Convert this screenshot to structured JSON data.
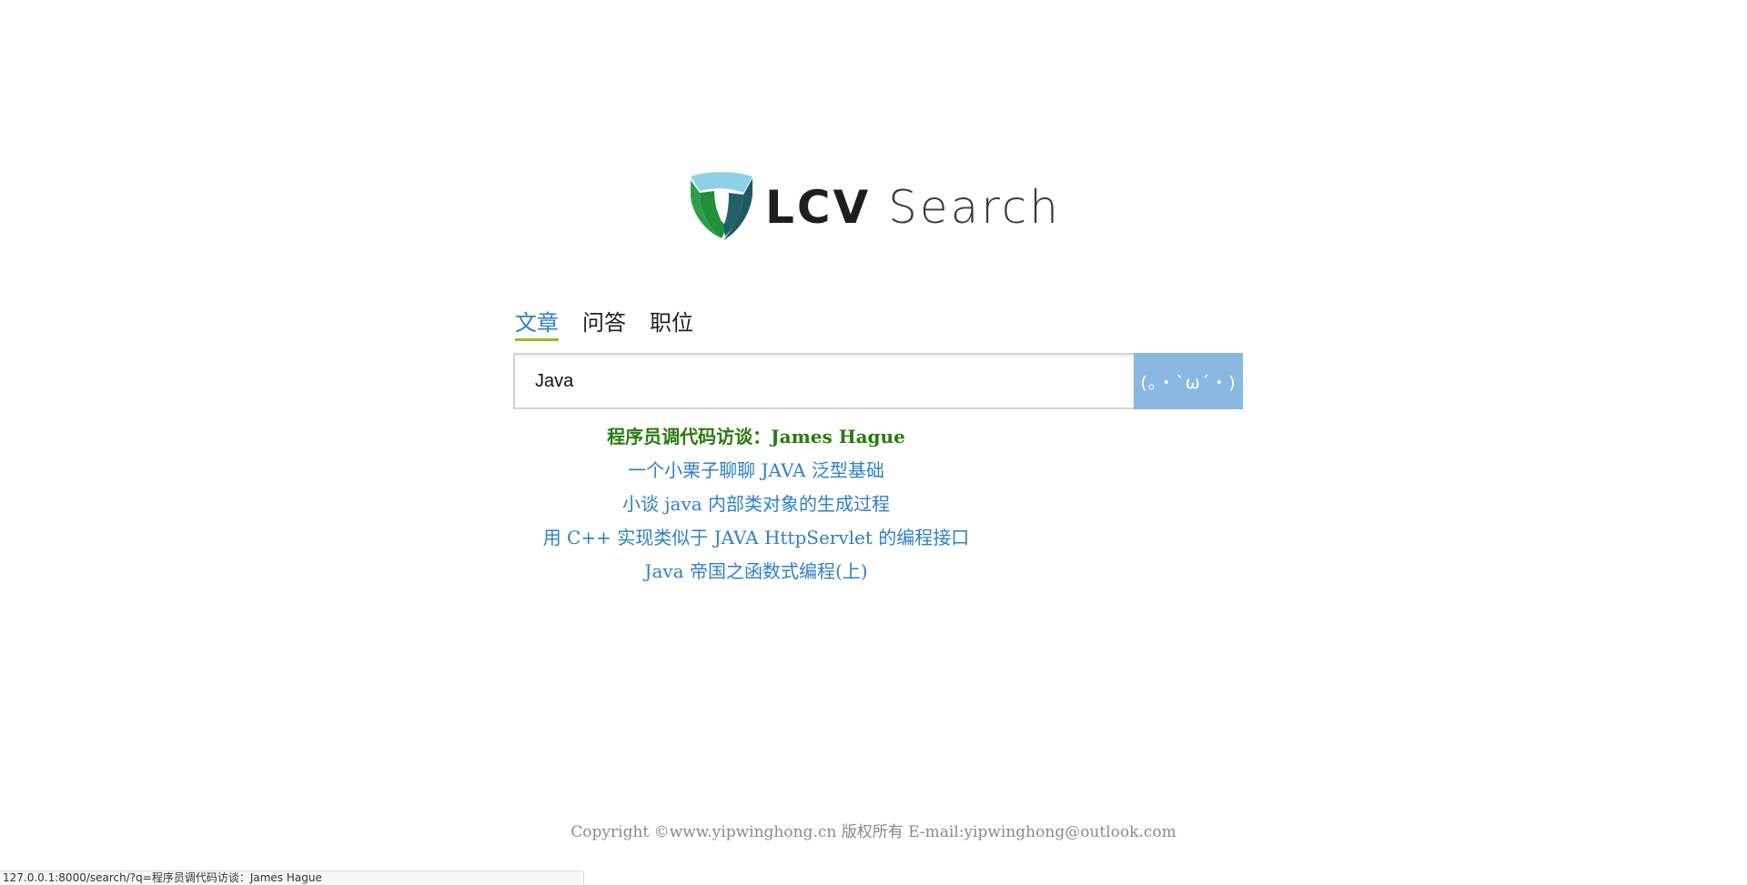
{
  "logo": {
    "text_bold": "LCV",
    "text_light": "Search",
    "colors": {
      "green": "#2aa046",
      "dark_teal": "#1d5a5e",
      "light_blue": "#8fd0e8"
    }
  },
  "tabs": [
    {
      "label": "文章",
      "active": true
    },
    {
      "label": "问答",
      "active": false
    },
    {
      "label": "职位",
      "active": false
    }
  ],
  "search": {
    "value": "Java",
    "placeholder": "",
    "button_label": "(｡・`ω´・)"
  },
  "suggestions": [
    {
      "text": "程序员调代码访谈：James Hague",
      "highlighted": true
    },
    {
      "text": "一个小栗子聊聊 JAVA 泛型基础",
      "highlighted": false
    },
    {
      "text": "小谈 java 内部类对象的生成过程",
      "highlighted": false
    },
    {
      "text": "用 C++ 实现类似于 JAVA HttpServlet 的编程接口",
      "highlighted": false
    },
    {
      "text": "Java 帝国之函数式编程(上)",
      "highlighted": false
    }
  ],
  "footer": {
    "text": "Copyright ©www.yipwinghong.cn 版权所有 E-mail:yipwinghong@outlook.com"
  },
  "status_bar": {
    "url": "127.0.0.1:8000/search/?q=程序员调代码访谈：James Hague"
  },
  "colors": {
    "accent_blue": "#2f7fc7",
    "highlight_green": "#2a7a0f",
    "tab_underline": "#8fc31f",
    "search_button": "#8ab8e0"
  }
}
